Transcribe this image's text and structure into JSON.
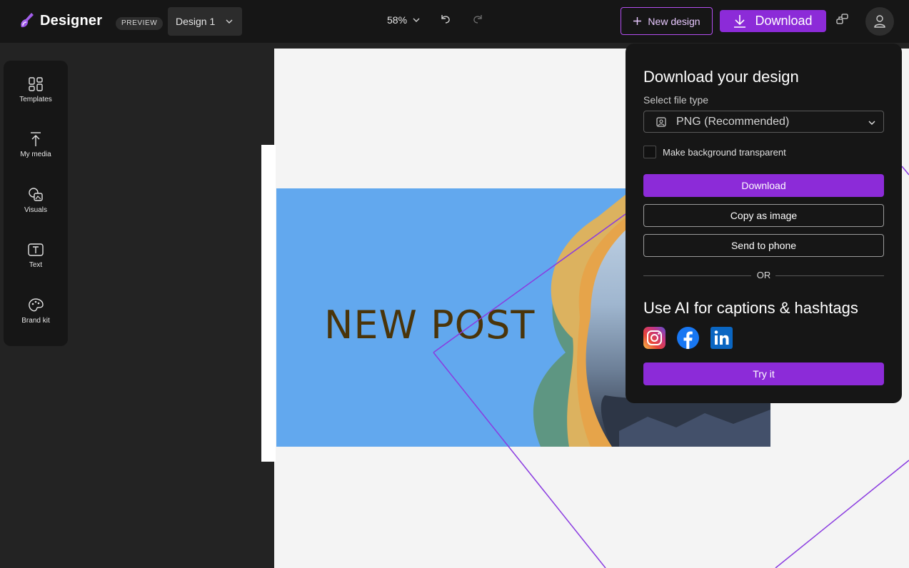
{
  "app": {
    "brand": "Designer",
    "preview_badge": "PREVIEW",
    "design_name": "Design 1",
    "zoom": "58%",
    "new_design_label": "New design",
    "download_label": "Download"
  },
  "sidebar": {
    "items": [
      {
        "label": "Templates",
        "icon": "templates-icon"
      },
      {
        "label": "My media",
        "icon": "upload-icon"
      },
      {
        "label": "Visuals",
        "icon": "visuals-icon"
      },
      {
        "label": "Text",
        "icon": "text-icon"
      },
      {
        "label": "Brand kit",
        "icon": "palette-icon"
      }
    ]
  },
  "canvas": {
    "post_title": "NEW POST",
    "background_color": "#62a8ee",
    "title_color": "#4a3409"
  },
  "download_panel": {
    "title": "Download your design",
    "file_type_label": "Select file type",
    "file_type_value": "PNG (Recommended)",
    "transparent_label": "Make background transparent",
    "transparent_checked": false,
    "download_button": "Download",
    "copy_button": "Copy as image",
    "phone_button": "Send to phone",
    "or_text": "OR",
    "ai_title": "Use AI for captions & hashtags",
    "social_icons": [
      "instagram-icon",
      "facebook-icon",
      "linkedin-icon"
    ],
    "try_button": "Try it"
  },
  "colors": {
    "accent": "#8c2bd8",
    "topbar": "#161616",
    "workspace": "#232323"
  }
}
